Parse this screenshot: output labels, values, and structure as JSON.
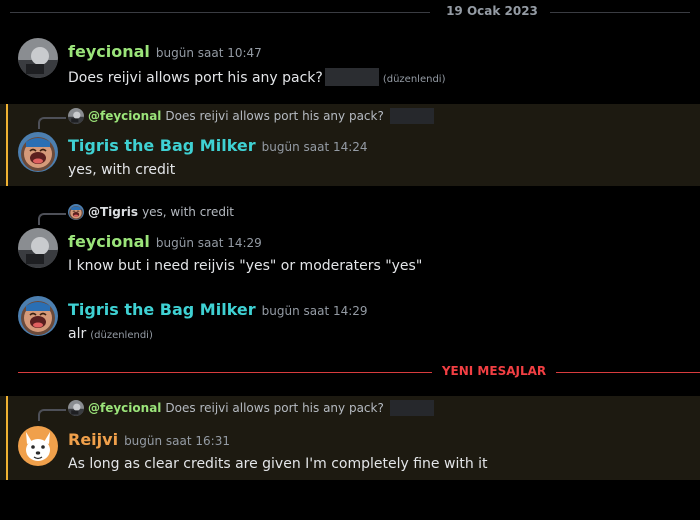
{
  "date_divider": "19 Ocak 2023",
  "new_messages_divider": "YENI MESAJLAR",
  "colors": {
    "background": "#000000",
    "highlight_bg": "#1d1a11",
    "highlight_bar": "#f0b232",
    "feycional": "#9be47a",
    "tigris": "#3fd1d3",
    "reijvi": "#f0a04b",
    "new_divider": "#f23f43"
  },
  "messages": [
    {
      "author": "feycional",
      "timestamp": "bugün saat 10:47",
      "text": "Does reijvi allows port his any pack?",
      "edited": "(düzenlendi)",
      "avatar_icon": "gray-avatar"
    },
    {
      "reply": {
        "mention": "@feycional",
        "text": "Does reijvi allows port his any pack?"
      },
      "author": "Tigris the Bag Milker",
      "timestamp": "bugün saat 14:24",
      "text": "yes, with credit",
      "avatar_icon": "laughing-face-avatar"
    },
    {
      "reply": {
        "mention": "@Tigris",
        "text": "yes, with credit"
      },
      "author": "feycional",
      "timestamp": "bugün saat 14:29",
      "text": "I know but i need reijvis \"yes\" or moderaters \"yes\"",
      "avatar_icon": "gray-avatar"
    },
    {
      "author": "Tigris the Bag Milker",
      "timestamp": "bugün saat 14:29",
      "text": "alr",
      "edited": "(düzenlendi)",
      "avatar_icon": "laughing-face-avatar"
    },
    {
      "reply": {
        "mention": "@feycional",
        "text": "Does reijvi allows port his any pack?"
      },
      "author": "Reijvi",
      "timestamp": "bugün saat 16:31",
      "text": "As long as clear credits are given I'm completely fine with it",
      "avatar_icon": "fox-avatar"
    }
  ]
}
